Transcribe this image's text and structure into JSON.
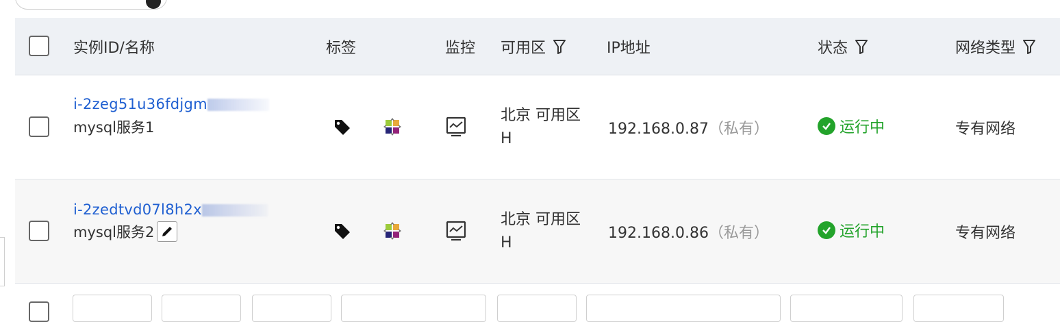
{
  "header": {
    "instance_col": "实例ID/名称",
    "tags_col": "标签",
    "monitor_col": "监控",
    "zone_col": "可用区",
    "ip_col": "IP地址",
    "status_col": "状态",
    "network_col": "网络类型"
  },
  "rows": [
    {
      "instance_id": "i-2zeg51u36fdjgm",
      "name": "mysql服务1",
      "zone_line1": "北京 可用区",
      "zone_line2": "H",
      "ip": "192.168.0.87",
      "ip_type": "（私有）",
      "status": "运行中",
      "network": "专有网络"
    },
    {
      "instance_id": "i-2zedtvd07l8h2x",
      "name": "mysql服务2",
      "zone_line1": "北京 可用区",
      "zone_line2": "H",
      "ip": "192.168.0.86",
      "ip_type": "（私有）",
      "status": "运行中",
      "network": "专有网络"
    }
  ],
  "icons": {
    "tag": "tag-icon",
    "os": "centos-icon",
    "monitor": "monitor-icon",
    "filter": "filter-icon",
    "status_ok": "check-circle-icon",
    "edit": "pencil-icon"
  },
  "colors": {
    "link": "#1f5fd1",
    "status_running": "#23a32b",
    "header_bg": "#eef1f5"
  }
}
